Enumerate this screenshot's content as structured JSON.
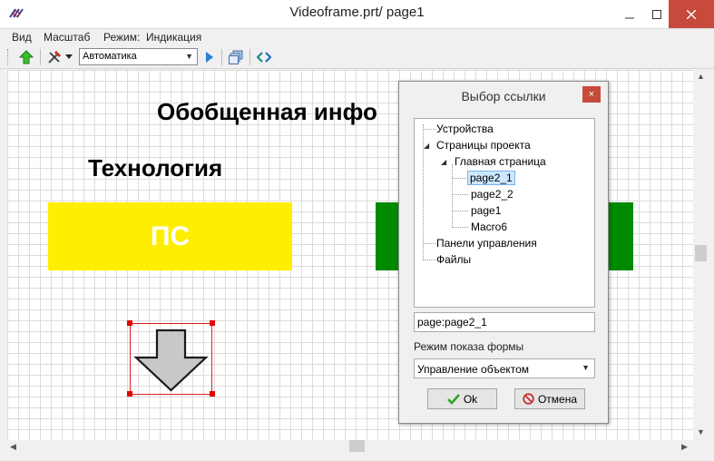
{
  "window": {
    "title": "Videoframe.prt/ page1"
  },
  "menu": {
    "items": [
      "Вид",
      "Масштаб",
      "Режим:",
      "Индикация"
    ]
  },
  "toolbar": {
    "mode_value": "Автоматика"
  },
  "canvas": {
    "heading": "Обобщенная инфо",
    "subheading": "Технология",
    "ps_label": "ПС",
    "colors": {
      "yellow_block": "#ffee00",
      "green_block": "#008a00",
      "selection": "#e00000"
    }
  },
  "dialog": {
    "title": "Выбор ссылки",
    "close_glyph": "×",
    "tree": {
      "devices": "Устройства",
      "project_pages": "Страницы проекта",
      "main_page": "Главная страница",
      "page2_1": "page2_1",
      "page2_2": "page2_2",
      "page1": "page1",
      "macro6": "Macro6",
      "control_panels": "Панели управления",
      "files": "Файлы"
    },
    "link_value": "page:page2_1",
    "mode_label": "Режим показа формы",
    "mode_value": "Управление объектом",
    "ok_label": "Ok",
    "cancel_label": "Отмена"
  }
}
